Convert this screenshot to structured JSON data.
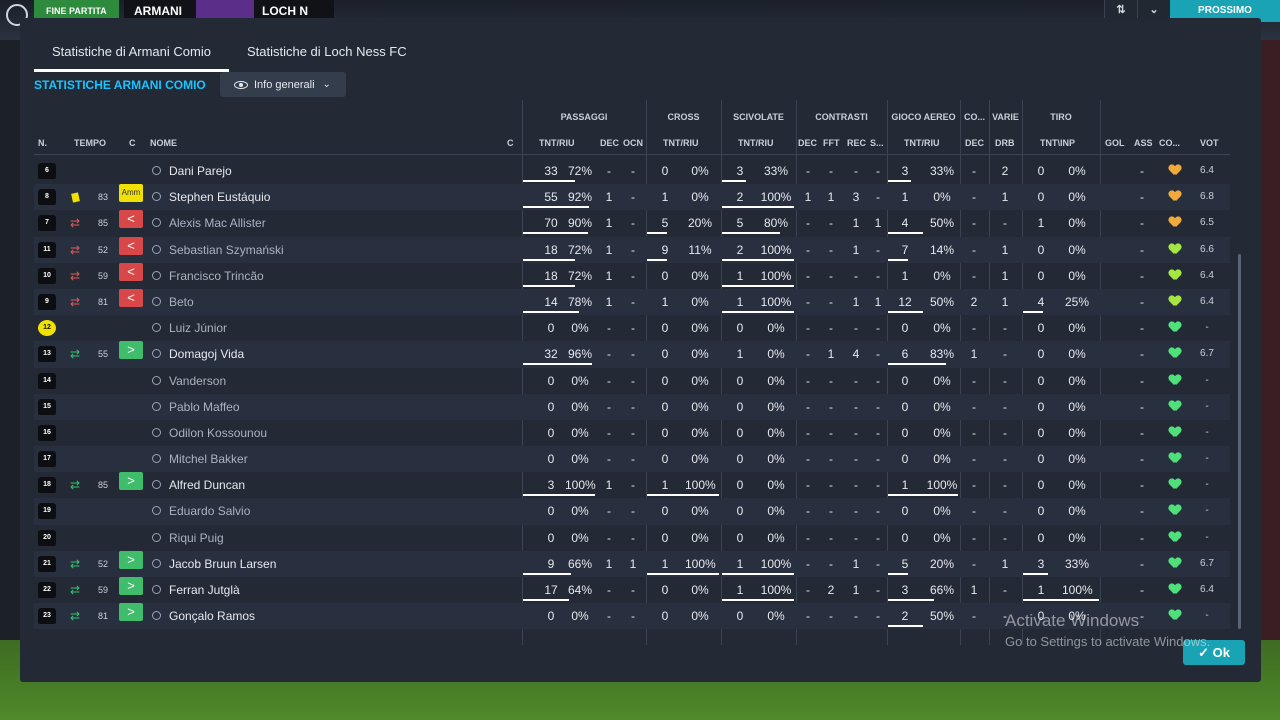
{
  "topbar": {
    "end_label": "FINE PARTITA",
    "home_team_short": "ARMANI",
    "away_team_short": "LOCH N",
    "continue_label": "PROSSIMO",
    "btn1": "⇅",
    "btn2": "⌄"
  },
  "tabs": [
    "Statistiche di Armani Comio",
    "Statistiche di Loch Ness FC"
  ],
  "team_title": "STATISTICHE ARMANI COMIO",
  "dropdown": {
    "label": "Info generali"
  },
  "headers": {
    "groups": [
      "PASSAGGI",
      "CROSS",
      "SCIVOLATE",
      "CONTRASTI",
      "GIOCO AEREO",
      "CO...",
      "VARIE",
      "TIRO"
    ],
    "cols": {
      "n": "N.",
      "tempo": "TEMPO",
      "c": "C",
      "nome": "NOME",
      "c2": "C",
      "p_tnt": "TNT/RIU",
      "p_dec": "DEC",
      "p_ocn": "OCN",
      "cr_tnt": "TNT/RIU",
      "sc_tnt": "TNT/RIU",
      "co_dec": "DEC",
      "co_fft": "FFT",
      "co_rec": "REC",
      "co_s": "S...",
      "ga_tnt": "TNT/RIU",
      "c3_dec": "DEC",
      "v_drb": "DRB",
      "t_tnt": "TNT\\INP",
      "gol": "GOL",
      "ass": "ASS",
      "cond": "CO...",
      "vot": "VOT"
    }
  },
  "colors": {
    "accent": "#19c3ff",
    "sub_out": "#d94848",
    "sub_in": "#3fbd6b",
    "card": "#f2e100",
    "heart_orange": "#f0a93a",
    "heart_lime": "#a6e640",
    "heart_green": "#4fe07a"
  },
  "rows": [
    {
      "num": "6",
      "event": "",
      "minute": "",
      "badge": "",
      "name": "Dani Parejo",
      "dim": false,
      "p_tnt": "33",
      "p_pct": "72%",
      "p_dec": "-",
      "p_ocn": "-",
      "cr_tnt": "0",
      "cr_pct": "0%",
      "sc_tnt": "3",
      "sc_pct": "33%",
      "co_dec": "-",
      "co_fft": "-",
      "co_rec": "-",
      "co_s": "-",
      "ga_tnt": "3",
      "ga_pct": "33%",
      "c3": "-",
      "drb": "2",
      "t_tnt": "0",
      "t_pct": "0%",
      "gol": "",
      "ass": "-",
      "heart": "orange",
      "vote": "6.4",
      "p_bar": 0.72,
      "cr_bar": 0,
      "sc_bar": 0.33,
      "ga_bar": 0.33,
      "t_bar": 0
    },
    {
      "num": "8",
      "event": "card",
      "minute": "83",
      "badge": "amm",
      "badge_text": "Amm",
      "name": "Stephen Eustáquio",
      "dim": false,
      "p_tnt": "55",
      "p_pct": "92%",
      "p_dec": "1",
      "p_ocn": "-",
      "cr_tnt": "1",
      "cr_pct": "0%",
      "sc_tnt": "2",
      "sc_pct": "100%",
      "co_dec": "1",
      "co_fft": "1",
      "co_rec": "3",
      "co_s": "-",
      "ga_tnt": "1",
      "ga_pct": "0%",
      "c3": "-",
      "drb": "1",
      "t_tnt": "0",
      "t_pct": "0%",
      "gol": "",
      "ass": "-",
      "heart": "orange",
      "vote": "6.8",
      "p_bar": 0.92,
      "cr_bar": 0,
      "sc_bar": 1,
      "ga_bar": 0,
      "t_bar": 0
    },
    {
      "num": "7",
      "event": "out",
      "minute": "85",
      "badge": "out",
      "name": "Alexis Mac Allister",
      "dim": true,
      "p_tnt": "70",
      "p_pct": "90%",
      "p_dec": "1",
      "p_ocn": "-",
      "cr_tnt": "5",
      "cr_pct": "20%",
      "sc_tnt": "5",
      "sc_pct": "80%",
      "co_dec": "-",
      "co_fft": "-",
      "co_rec": "1",
      "co_s": "1",
      "ga_tnt": "4",
      "ga_pct": "50%",
      "c3": "-",
      "drb": "-",
      "t_tnt": "1",
      "t_pct": "0%",
      "gol": "",
      "ass": "-",
      "heart": "orange",
      "vote": "6.5",
      "p_bar": 0.9,
      "cr_bar": 0.2,
      "sc_bar": 0.8,
      "ga_bar": 0.5,
      "t_bar": 0
    },
    {
      "num": "11",
      "event": "out",
      "minute": "52",
      "badge": "out",
      "name": "Sebastian Szymański",
      "dim": true,
      "p_tnt": "18",
      "p_pct": "72%",
      "p_dec": "1",
      "p_ocn": "-",
      "cr_tnt": "9",
      "cr_pct": "11%",
      "sc_tnt": "2",
      "sc_pct": "100%",
      "co_dec": "-",
      "co_fft": "-",
      "co_rec": "1",
      "co_s": "-",
      "ga_tnt": "7",
      "ga_pct": "14%",
      "c3": "-",
      "drb": "1",
      "t_tnt": "0",
      "t_pct": "0%",
      "gol": "",
      "ass": "-",
      "heart": "lime",
      "vote": "6.6",
      "p_bar": 0.72,
      "cr_bar": 0.11,
      "sc_bar": 1,
      "ga_bar": 0.14,
      "t_bar": 0
    },
    {
      "num": "10",
      "event": "out",
      "minute": "59",
      "badge": "out",
      "name": "Francisco Trincão",
      "dim": true,
      "p_tnt": "18",
      "p_pct": "72%",
      "p_dec": "1",
      "p_ocn": "-",
      "cr_tnt": "0",
      "cr_pct": "0%",
      "sc_tnt": "1",
      "sc_pct": "100%",
      "co_dec": "-",
      "co_fft": "-",
      "co_rec": "-",
      "co_s": "-",
      "ga_tnt": "1",
      "ga_pct": "0%",
      "c3": "-",
      "drb": "1",
      "t_tnt": "0",
      "t_pct": "0%",
      "gol": "",
      "ass": "-",
      "heart": "lime",
      "vote": "6.4",
      "p_bar": 0.72,
      "cr_bar": 0,
      "sc_bar": 1,
      "ga_bar": 0,
      "t_bar": 0
    },
    {
      "num": "9",
      "event": "out",
      "minute": "81",
      "badge": "out",
      "name": "Beto",
      "dim": true,
      "p_tnt": "14",
      "p_pct": "78%",
      "p_dec": "1",
      "p_ocn": "-",
      "cr_tnt": "1",
      "cr_pct": "0%",
      "sc_tnt": "1",
      "sc_pct": "100%",
      "co_dec": "-",
      "co_fft": "-",
      "co_rec": "1",
      "co_s": "1",
      "ga_tnt": "12",
      "ga_pct": "50%",
      "c3": "2",
      "drb": "1",
      "t_tnt": "4",
      "t_pct": "25%",
      "gol": "",
      "ass": "-",
      "heart": "lime",
      "vote": "6.4",
      "p_bar": 0.78,
      "cr_bar": 0,
      "sc_bar": 1,
      "ga_bar": 0.5,
      "t_bar": 0.25
    },
    {
      "num": "12",
      "gk": true,
      "event": "",
      "minute": "",
      "badge": "",
      "name": "Luiz Júnior",
      "dim": true,
      "p_tnt": "0",
      "p_pct": "0%",
      "p_dec": "-",
      "p_ocn": "-",
      "cr_tnt": "0",
      "cr_pct": "0%",
      "sc_tnt": "0",
      "sc_pct": "0%",
      "co_dec": "-",
      "co_fft": "-",
      "co_rec": "-",
      "co_s": "-",
      "ga_tnt": "0",
      "ga_pct": "0%",
      "c3": "-",
      "drb": "-",
      "t_tnt": "0",
      "t_pct": "0%",
      "gol": "",
      "ass": "-",
      "heart": "green",
      "vote": "-",
      "p_bar": 0,
      "cr_bar": 0,
      "sc_bar": 0,
      "ga_bar": 0,
      "t_bar": 0
    },
    {
      "num": "13",
      "event": "in",
      "minute": "55",
      "badge": "in",
      "name": "Domagoj Vida",
      "dim": false,
      "p_tnt": "32",
      "p_pct": "96%",
      "p_dec": "-",
      "p_ocn": "-",
      "cr_tnt": "0",
      "cr_pct": "0%",
      "sc_tnt": "1",
      "sc_pct": "0%",
      "co_dec": "-",
      "co_fft": "1",
      "co_rec": "4",
      "co_s": "-",
      "ga_tnt": "6",
      "ga_pct": "83%",
      "c3": "1",
      "drb": "-",
      "t_tnt": "0",
      "t_pct": "0%",
      "gol": "",
      "ass": "-",
      "heart": "green",
      "vote": "6.7",
      "p_bar": 0.96,
      "cr_bar": 0,
      "sc_bar": 0,
      "ga_bar": 0.83,
      "t_bar": 0
    },
    {
      "num": "14",
      "event": "",
      "minute": "",
      "badge": "",
      "name": "Vanderson",
      "dim": true,
      "p_tnt": "0",
      "p_pct": "0%",
      "p_dec": "-",
      "p_ocn": "-",
      "cr_tnt": "0",
      "cr_pct": "0%",
      "sc_tnt": "0",
      "sc_pct": "0%",
      "co_dec": "-",
      "co_fft": "-",
      "co_rec": "-",
      "co_s": "-",
      "ga_tnt": "0",
      "ga_pct": "0%",
      "c3": "-",
      "drb": "-",
      "t_tnt": "0",
      "t_pct": "0%",
      "gol": "",
      "ass": "-",
      "heart": "green",
      "vote": "-",
      "p_bar": 0,
      "cr_bar": 0,
      "sc_bar": 0,
      "ga_bar": 0,
      "t_bar": 0
    },
    {
      "num": "15",
      "event": "",
      "minute": "",
      "badge": "",
      "name": "Pablo Maffeo",
      "dim": true,
      "p_tnt": "0",
      "p_pct": "0%",
      "p_dec": "-",
      "p_ocn": "-",
      "cr_tnt": "0",
      "cr_pct": "0%",
      "sc_tnt": "0",
      "sc_pct": "0%",
      "co_dec": "-",
      "co_fft": "-",
      "co_rec": "-",
      "co_s": "-",
      "ga_tnt": "0",
      "ga_pct": "0%",
      "c3": "-",
      "drb": "-",
      "t_tnt": "0",
      "t_pct": "0%",
      "gol": "",
      "ass": "-",
      "heart": "green",
      "vote": "-",
      "p_bar": 0,
      "cr_bar": 0,
      "sc_bar": 0,
      "ga_bar": 0,
      "t_bar": 0
    },
    {
      "num": "16",
      "event": "",
      "minute": "",
      "badge": "",
      "name": "Odilon Kossounou",
      "dim": true,
      "p_tnt": "0",
      "p_pct": "0%",
      "p_dec": "-",
      "p_ocn": "-",
      "cr_tnt": "0",
      "cr_pct": "0%",
      "sc_tnt": "0",
      "sc_pct": "0%",
      "co_dec": "-",
      "co_fft": "-",
      "co_rec": "-",
      "co_s": "-",
      "ga_tnt": "0",
      "ga_pct": "0%",
      "c3": "-",
      "drb": "-",
      "t_tnt": "0",
      "t_pct": "0%",
      "gol": "",
      "ass": "-",
      "heart": "green",
      "vote": "-",
      "p_bar": 0,
      "cr_bar": 0,
      "sc_bar": 0,
      "ga_bar": 0,
      "t_bar": 0
    },
    {
      "num": "17",
      "event": "",
      "minute": "",
      "badge": "",
      "name": "Mitchel Bakker",
      "dim": true,
      "p_tnt": "0",
      "p_pct": "0%",
      "p_dec": "-",
      "p_ocn": "-",
      "cr_tnt": "0",
      "cr_pct": "0%",
      "sc_tnt": "0",
      "sc_pct": "0%",
      "co_dec": "-",
      "co_fft": "-",
      "co_rec": "-",
      "co_s": "-",
      "ga_tnt": "0",
      "ga_pct": "0%",
      "c3": "-",
      "drb": "-",
      "t_tnt": "0",
      "t_pct": "0%",
      "gol": "",
      "ass": "-",
      "heart": "green",
      "vote": "-",
      "p_bar": 0,
      "cr_bar": 0,
      "sc_bar": 0,
      "ga_bar": 0,
      "t_bar": 0
    },
    {
      "num": "18",
      "event": "in",
      "minute": "85",
      "badge": "in",
      "name": "Alfred Duncan",
      "dim": false,
      "p_tnt": "3",
      "p_pct": "100%",
      "p_dec": "1",
      "p_ocn": "-",
      "cr_tnt": "1",
      "cr_pct": "100%",
      "sc_tnt": "0",
      "sc_pct": "0%",
      "co_dec": "-",
      "co_fft": "-",
      "co_rec": "-",
      "co_s": "-",
      "ga_tnt": "1",
      "ga_pct": "100%",
      "c3": "-",
      "drb": "-",
      "t_tnt": "0",
      "t_pct": "0%",
      "gol": "",
      "ass": "-",
      "heart": "green",
      "vote": "-",
      "p_bar": 1,
      "cr_bar": 1,
      "sc_bar": 0,
      "ga_bar": 1,
      "t_bar": 0
    },
    {
      "num": "19",
      "event": "",
      "minute": "",
      "badge": "",
      "name": "Eduardo Salvio",
      "dim": true,
      "p_tnt": "0",
      "p_pct": "0%",
      "p_dec": "-",
      "p_ocn": "-",
      "cr_tnt": "0",
      "cr_pct": "0%",
      "sc_tnt": "0",
      "sc_pct": "0%",
      "co_dec": "-",
      "co_fft": "-",
      "co_rec": "-",
      "co_s": "-",
      "ga_tnt": "0",
      "ga_pct": "0%",
      "c3": "-",
      "drb": "-",
      "t_tnt": "0",
      "t_pct": "0%",
      "gol": "",
      "ass": "-",
      "heart": "green",
      "vote": "-",
      "p_bar": 0,
      "cr_bar": 0,
      "sc_bar": 0,
      "ga_bar": 0,
      "t_bar": 0
    },
    {
      "num": "20",
      "event": "",
      "minute": "",
      "badge": "",
      "name": "Riqui Puig",
      "dim": true,
      "p_tnt": "0",
      "p_pct": "0%",
      "p_dec": "-",
      "p_ocn": "-",
      "cr_tnt": "0",
      "cr_pct": "0%",
      "sc_tnt": "0",
      "sc_pct": "0%",
      "co_dec": "-",
      "co_fft": "-",
      "co_rec": "-",
      "co_s": "-",
      "ga_tnt": "0",
      "ga_pct": "0%",
      "c3": "-",
      "drb": "-",
      "t_tnt": "0",
      "t_pct": "0%",
      "gol": "",
      "ass": "-",
      "heart": "green",
      "vote": "-",
      "p_bar": 0,
      "cr_bar": 0,
      "sc_bar": 0,
      "ga_bar": 0,
      "t_bar": 0
    },
    {
      "num": "21",
      "event": "in",
      "minute": "52",
      "badge": "in",
      "name": "Jacob Bruun Larsen",
      "dim": false,
      "p_tnt": "9",
      "p_pct": "66%",
      "p_dec": "1",
      "p_ocn": "1",
      "cr_tnt": "1",
      "cr_pct": "100%",
      "sc_tnt": "1",
      "sc_pct": "100%",
      "co_dec": "-",
      "co_fft": "-",
      "co_rec": "1",
      "co_s": "-",
      "ga_tnt": "5",
      "ga_pct": "20%",
      "c3": "-",
      "drb": "1",
      "t_tnt": "3",
      "t_pct": "33%",
      "gol": "",
      "ass": "-",
      "heart": "green",
      "vote": "6.7",
      "p_bar": 0.66,
      "cr_bar": 1,
      "sc_bar": 1,
      "ga_bar": 0.2,
      "t_bar": 0.33
    },
    {
      "num": "22",
      "event": "in",
      "minute": "59",
      "badge": "in",
      "name": "Ferran Jutglà",
      "dim": false,
      "p_tnt": "17",
      "p_pct": "64%",
      "p_dec": "-",
      "p_ocn": "-",
      "cr_tnt": "0",
      "cr_pct": "0%",
      "sc_tnt": "1",
      "sc_pct": "100%",
      "co_dec": "-",
      "co_fft": "2",
      "co_rec": "1",
      "co_s": "-",
      "ga_tnt": "3",
      "ga_pct": "66%",
      "c3": "1",
      "drb": "-",
      "t_tnt": "1",
      "t_pct": "100%",
      "gol": "",
      "ass": "-",
      "heart": "green",
      "vote": "6.4",
      "p_bar": 0.64,
      "cr_bar": 0,
      "sc_bar": 1,
      "ga_bar": 0.66,
      "t_bar": 1
    },
    {
      "num": "23",
      "event": "in",
      "minute": "81",
      "badge": "in",
      "name": "Gonçalo Ramos",
      "dim": false,
      "p_tnt": "0",
      "p_pct": "0%",
      "p_dec": "-",
      "p_ocn": "-",
      "cr_tnt": "0",
      "cr_pct": "0%",
      "sc_tnt": "0",
      "sc_pct": "0%",
      "co_dec": "-",
      "co_fft": "-",
      "co_rec": "-",
      "co_s": "-",
      "ga_tnt": "2",
      "ga_pct": "50%",
      "c3": "-",
      "drb": "-",
      "t_tnt": "0",
      "t_pct": "0%",
      "gol": "",
      "ass": "-",
      "heart": "green",
      "vote": "-",
      "p_bar": 0,
      "cr_bar": 0,
      "sc_bar": 0,
      "ga_bar": 0.5,
      "t_bar": 0
    }
  ],
  "ok_label": "Ok",
  "watermark": {
    "line1": "Activate Windows",
    "line2": "Go to Settings to activate Windows."
  }
}
